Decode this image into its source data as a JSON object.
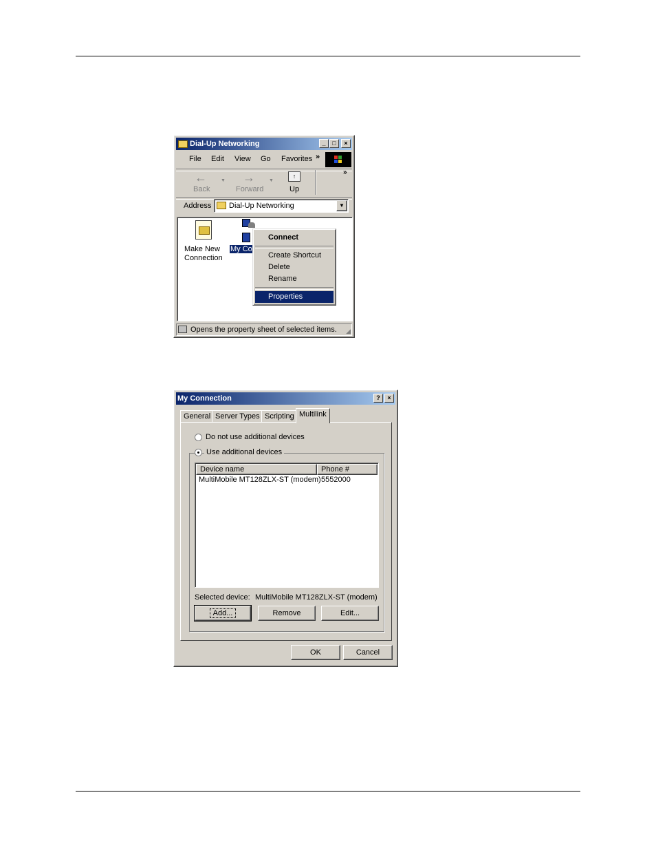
{
  "dun": {
    "title": "Dial-Up Networking",
    "menu": [
      "File",
      "Edit",
      "View",
      "Go",
      "Favorites"
    ],
    "menu_more": "»",
    "toolbar": {
      "back": "Back",
      "forward": "Forward",
      "up": "Up",
      "more": "»"
    },
    "address_label": "Address",
    "address_value": "Dial-Up Networking",
    "items": {
      "make_new": "Make New\nConnection",
      "my_conn": "My Co"
    },
    "context_menu": [
      "Connect",
      "Create Shortcut",
      "Delete",
      "Rename",
      "Properties"
    ],
    "status": "Opens the property sheet of selected items."
  },
  "dlg": {
    "title": "My Connection",
    "tabs": [
      "General",
      "Server Types",
      "Scripting",
      "Multilink"
    ],
    "radio_no": "Do not use additional devices",
    "radio_yes": "Use additional devices",
    "columns": [
      "Device name",
      "Phone #"
    ],
    "rows": [
      {
        "device": "MultiMobile MT128ZLX-ST (modem)",
        "phone": "5552000"
      }
    ],
    "selected_label": "Selected device:",
    "selected_value": "MultiMobile MT128ZLX-ST (modem)",
    "buttons": {
      "add": "Add...",
      "remove": "Remove",
      "edit": "Edit...",
      "ok": "OK",
      "cancel": "Cancel"
    }
  }
}
